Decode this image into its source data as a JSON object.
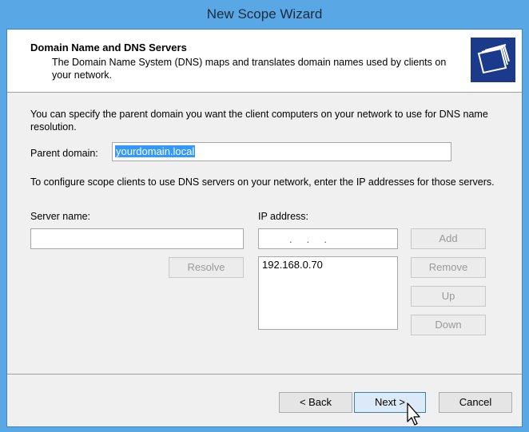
{
  "window": {
    "title": "New Scope Wizard"
  },
  "header": {
    "title": "Domain Name and DNS Servers",
    "subtitle": "The Domain Name System (DNS) maps and translates domain names used by clients on your network.",
    "icon": "folders-icon"
  },
  "body": {
    "parent_help": "You can specify the parent domain you want the client computers on your network to use for DNS name resolution.",
    "parent_label": "Parent domain:",
    "parent_value": "yourdomain.local",
    "dns_help": "To configure scope clients to use DNS servers on your network, enter the IP addresses for those servers.",
    "server_label": "Server name:",
    "server_value": "",
    "ip_label": "IP address:",
    "ip_value": ".     .     .",
    "ip_list": [
      "192.168.0.70"
    ]
  },
  "buttons": {
    "resolve": "Resolve",
    "add": "Add",
    "remove": "Remove",
    "up": "Up",
    "down": "Down",
    "back": "< Back",
    "next": "Next >",
    "cancel": "Cancel"
  }
}
